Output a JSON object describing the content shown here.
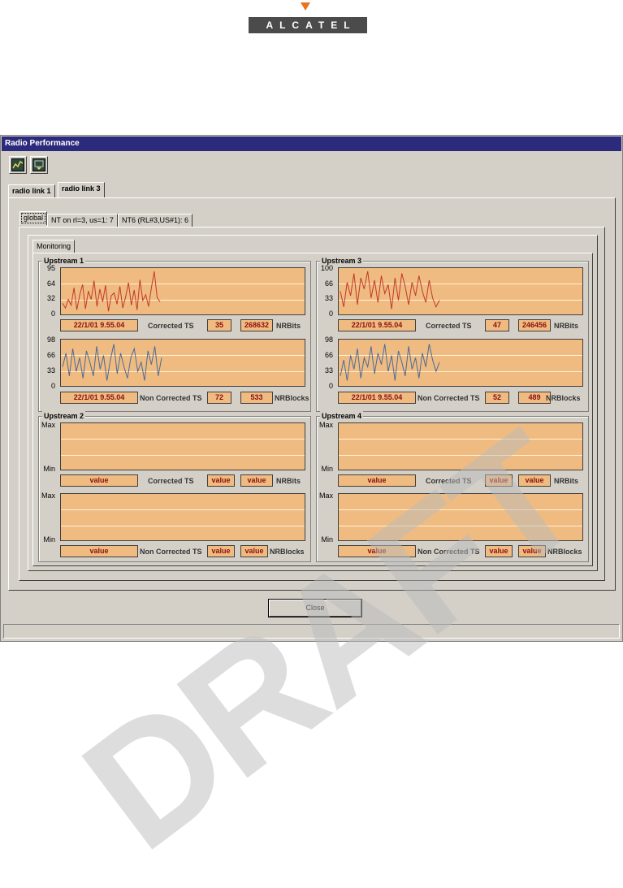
{
  "logo": {
    "text": "ALCATEL",
    "accent_color": "#e8721d"
  },
  "window": {
    "title": "Radio Performance"
  },
  "toolbar": {
    "buttons": [
      "graph-icon",
      "export-icon"
    ]
  },
  "tabs": {
    "outer": [
      "radio link 1",
      "radio link 3"
    ],
    "selected": "radio link 3"
  },
  "subtabs": {
    "items": [
      "global",
      "NT on rl=3, us=1: 7",
      "NT6 (RL#3,US#1): 6"
    ],
    "selected": "global"
  },
  "monitoring_tab": "Monitoring",
  "labels": {
    "corrected": "Corrected TS",
    "non_corrected": "Non Corrected TS",
    "nrbits": "NRBits",
    "nrblocks": "NRBlocks",
    "max": "Max",
    "min": "Min"
  },
  "groups": [
    {
      "title": "Upstream 1",
      "top_axis": [
        "95",
        "64",
        "32",
        "0"
      ],
      "bottom_axis": [
        "98",
        "66",
        "33",
        "0"
      ],
      "corrected": {
        "time": "22/1/01 9.55.04",
        "ts": "35",
        "bits": "268632"
      },
      "non_corrected": {
        "time": "22/1/01 9.55.04",
        "ts": "72",
        "blocks": "533"
      }
    },
    {
      "title": "Upstream 3",
      "top_axis": [
        "100",
        "66",
        "33",
        "0"
      ],
      "bottom_axis": [
        "98",
        "66",
        "33",
        "0"
      ],
      "corrected": {
        "time": "22/1/01 9.55.04",
        "ts": "47",
        "bits": "246456"
      },
      "non_corrected": {
        "time": "22/1/01 9.55.04",
        "ts": "52",
        "blocks": "489"
      }
    },
    {
      "title": "Upstream 2",
      "corrected": {
        "time": "value",
        "ts": "value",
        "bits": "value"
      },
      "non_corrected": {
        "time": "value",
        "ts": "value",
        "blocks": "value"
      }
    },
    {
      "title": "Upstream 4",
      "corrected": {
        "time": "value",
        "ts": "value",
        "bits": "value"
      },
      "non_corrected": {
        "time": "value",
        "ts": "value",
        "blocks": "value"
      }
    }
  ],
  "close_label": "Close",
  "watermark": "DRAFT",
  "chart_data": [
    {
      "type": "line",
      "color": "#c0392b",
      "ylim": [
        0,
        95
      ],
      "values": [
        22,
        12,
        30,
        18,
        55,
        8,
        40,
        62,
        10,
        48,
        30,
        70,
        15,
        52,
        25,
        60,
        5,
        38,
        44,
        20,
        58,
        12,
        35,
        66,
        18,
        50,
        8,
        72,
        28,
        40,
        15,
        55,
        90,
        34,
        25
      ]
    },
    {
      "type": "line",
      "color": "#4a6a9a",
      "ylim": [
        0,
        98
      ],
      "values": [
        40,
        70,
        20,
        80,
        30,
        60,
        15,
        75,
        50,
        20,
        85,
        35,
        65,
        10,
        55,
        90,
        25,
        70,
        40,
        15,
        60,
        80,
        30,
        50,
        10,
        75,
        45,
        85,
        20,
        60
      ]
    },
    {
      "type": "line",
      "color": "#c0392b",
      "ylim": [
        0,
        100
      ],
      "values": [
        50,
        15,
        70,
        40,
        90,
        20,
        80,
        55,
        95,
        35,
        75,
        25,
        85,
        45,
        65,
        10,
        80,
        30,
        90,
        60,
        20,
        70,
        40,
        85,
        50,
        25,
        75,
        35,
        15,
        30
      ]
    },
    {
      "type": "line",
      "color": "#4a6a9a",
      "ylim": [
        0,
        98
      ],
      "values": [
        20,
        55,
        10,
        65,
        35,
        80,
        15,
        60,
        40,
        85,
        25,
        70,
        45,
        90,
        30,
        65,
        10,
        75,
        50,
        20,
        85,
        35,
        60,
        15,
        70,
        40,
        90,
        55,
        30,
        50
      ]
    }
  ]
}
